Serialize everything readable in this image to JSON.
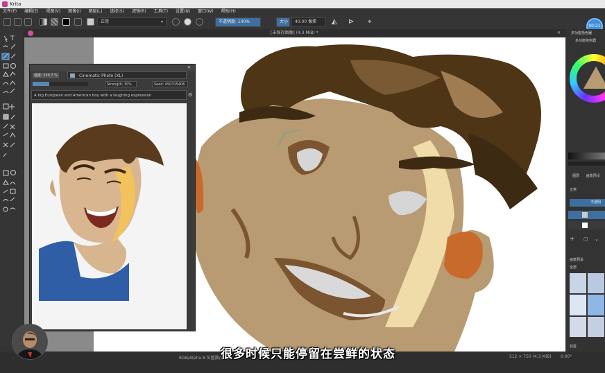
{
  "window": {
    "title": "Krita"
  },
  "menu": [
    "文件(F)",
    "编辑(E)",
    "视图(V)",
    "图像(I)",
    "图层(L)",
    "选择(S)",
    "滤镜(R)",
    "工具(T)",
    "设置(N)",
    "窗口(W)",
    "帮助(H)"
  ],
  "toolbar": {
    "blend_mode": "正常",
    "opacity_label": "不透明度: 100%",
    "size_label": "大小",
    "size_value": "40.00 像素",
    "timer": "00:21"
  },
  "document": {
    "tab_title": "[未保存图像] (4.3 MiB) *"
  },
  "ai_panel": {
    "strength_prefix": "强度: 250.7 %",
    "model": "Cinematic Photo (XL)",
    "strength": "Strength: 30%",
    "seed": "Seed: 450315406",
    "prompt": "A big European and American boy with a laughing expression"
  },
  "right_dock": {
    "header": "多功能拾色器",
    "subheader": "多功能拾色器",
    "tab_layers": "图层",
    "tab_other": "画笔预设",
    "layer_mode": "正常",
    "opacity_button": "不透明",
    "brush_label": "画笔预设",
    "brush_filter": "全部",
    "brush_search": "标签"
  },
  "status": {
    "color_mode": "RGB/Alpha 8 位整数/通道",
    "dimensions": "512 × 750 (4.3 MiB)",
    "rotation": "0.00°"
  },
  "subtitle": "很多时候只能停留在尝鲜的状态",
  "colors": {
    "accent": "#3e6f9f",
    "timer": "#3d8fe0"
  }
}
